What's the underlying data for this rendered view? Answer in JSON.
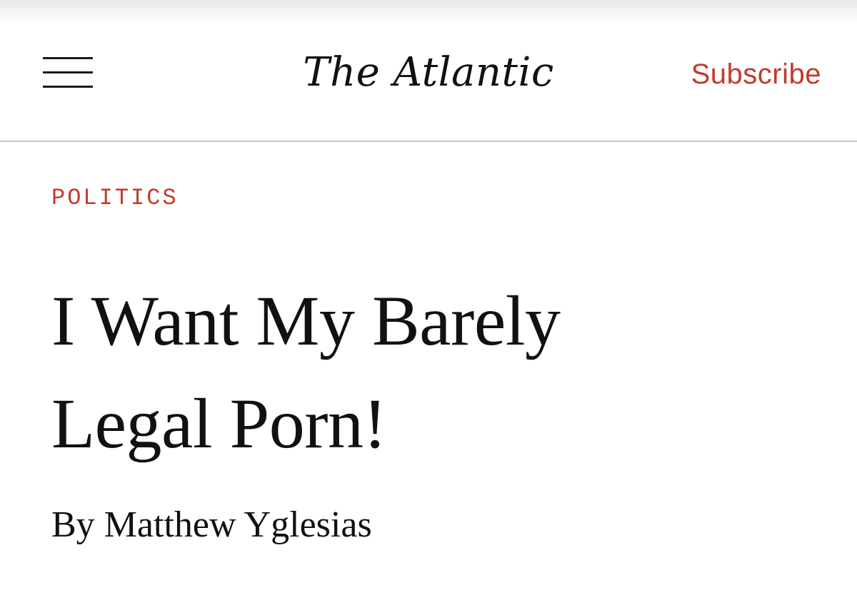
{
  "header": {
    "menu_icon": "hamburger-menu-icon",
    "logo_text": "The Atlantic",
    "subscribe_label": "Subscribe"
  },
  "article": {
    "section": "POLITICS",
    "headline_line1": "I Want My Barely",
    "headline_line2": "Legal Porn!",
    "byline_prefix": "By",
    "author": "Matthew Yglesias"
  },
  "colors": {
    "accent": "#c23a2f",
    "text": "#111111",
    "divider": "#c9c9c9",
    "background": "#ffffff"
  }
}
